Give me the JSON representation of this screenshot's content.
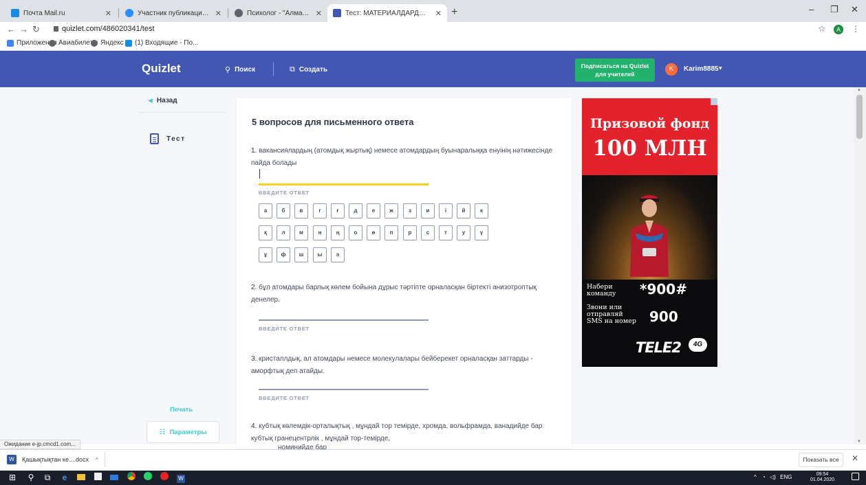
{
  "browser": {
    "tabs": [
      {
        "title": "Почта Mail.ru",
        "favicon_color": "#168de2"
      },
      {
        "title": "Участник публикации - Zoom",
        "favicon_color": "#2d8cff"
      },
      {
        "title": "Психолог - \"Алматы облысты…",
        "favicon_color": "#5f6368"
      },
      {
        "title": "Тест: МАТЕРИАЛДАРДЫҢ ҚҰРЫ…",
        "favicon_color": "#4257b2"
      }
    ],
    "url": "quizlet.com/486020341/test",
    "profile_initial": "A",
    "bookmarks": [
      {
        "label": "Приложения",
        "color": "#4285f4"
      },
      {
        "label": "Авиабилеты",
        "color": "#5f6368"
      },
      {
        "label": "Яндекс",
        "color": "#5f6368"
      },
      {
        "label": "(1) Входящие - По...",
        "color": "#168de2"
      }
    ]
  },
  "header": {
    "logo": "Quizlet",
    "search": "Поиск",
    "create": "Создать",
    "subscribe": "Подписаться на Quizlet для учителей",
    "user_initial": "K",
    "username": "Karim8885"
  },
  "sidebar": {
    "back": "Назад",
    "mode": "Тест",
    "print": "Печать",
    "params": "Параметры"
  },
  "main": {
    "section_title": "5 вопросов для письменного ответа",
    "answer_placeholder": "ВВЕДИТЕ ОТВЕТ",
    "questions": [
      {
        "num": "1.",
        "text": "вакансиялардың (атомдық жыртық) немесе атомдардың буынаралыққа енуінің нәтижесінде пайда болады"
      },
      {
        "num": "2.",
        "text": "бұл атомдары барлық көлем бойына дұрыс тәртіпте орналасқан біртекті анизотроптық денелер."
      },
      {
        "num": "3.",
        "text": "кристаллдық, ал атомдары немесе молекулалары бейберекет орналасқан заттарды - аморфтық деп атайды."
      },
      {
        "num": "4.",
        "text": "кубтық көлемдік-орталықтық , мұндай тор темірде, хромда, вольфрамда, ванадийде бар кубтық гранецентрлік , мұндай тор-темірде,"
      }
    ],
    "q4_cutoff": "номинийде бар",
    "keyboard": [
      [
        "а",
        "б",
        "в",
        "г",
        "ғ",
        "д",
        "е",
        "ж",
        "з",
        "и",
        "і",
        "й",
        "к"
      ],
      [
        "қ",
        "л",
        "м",
        "н",
        "ң",
        "о",
        "ө",
        "п",
        "р",
        "с",
        "т",
        "у",
        "ү"
      ],
      [
        "ұ",
        "ф",
        "ш",
        "ы",
        "э"
      ]
    ]
  },
  "ad": {
    "line1": "Призовой фонд",
    "line2": "100 МЛН",
    "dial_text": "Набери команду",
    "dial_code": "*900#",
    "sms_text": "Звони или отправляй SMS на номер",
    "sms_number": "900",
    "brand": "TELE2",
    "brand_badge": "4G"
  },
  "status_text": "Ожидание e-jp.cmcd1.com...",
  "downloads": {
    "file": "Қашықтықтан ке....docx",
    "show_all": "Показать все"
  },
  "taskbar": {
    "lang": "ENG",
    "time": "09:54",
    "date": "01.04.2020"
  }
}
